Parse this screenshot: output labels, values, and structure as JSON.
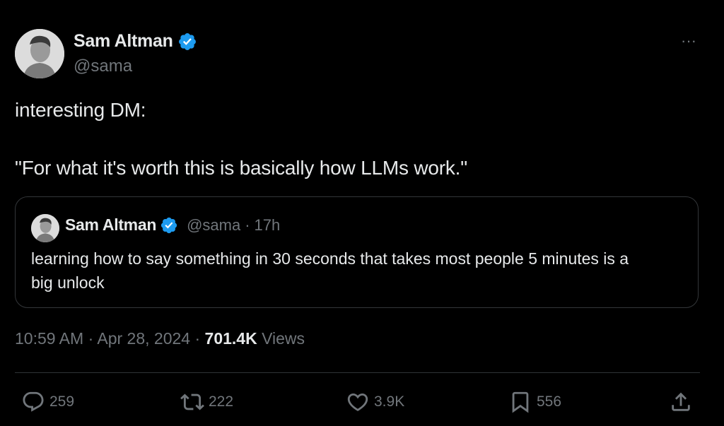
{
  "tweet": {
    "author": {
      "name": "Sam Altman",
      "handle": "@sama",
      "verified": true
    },
    "text_line1": "interesting DM:",
    "text_line2": "\"For what it's worth this is basically how LLMs work.\"",
    "quote": {
      "name": "Sam Altman",
      "handle": "@sama",
      "separator": "·",
      "time": "17h",
      "text": "learning how to say something in 30 seconds that takes most people 5 minutes is a big unlock"
    },
    "meta": {
      "time": "10:59 AM",
      "sep1": "·",
      "date": "Apr 28, 2024",
      "sep2": "·",
      "views_count": "701.4K",
      "views_label": "Views"
    },
    "actions": {
      "reply_count": "259",
      "retweet_count": "222",
      "like_count": "3.9K",
      "bookmark_count": "556"
    },
    "more_label": "···"
  },
  "icons": {
    "verified": "verified-badge-icon",
    "reply": "reply-icon",
    "retweet": "retweet-icon",
    "like": "heart-icon",
    "bookmark": "bookmark-icon",
    "share": "share-icon",
    "more": "more-dots-icon"
  },
  "colors": {
    "background": "#000000",
    "text": "#e7e9ea",
    "muted": "#71767b",
    "verified": "#1d9bf0",
    "border": "#333639"
  }
}
